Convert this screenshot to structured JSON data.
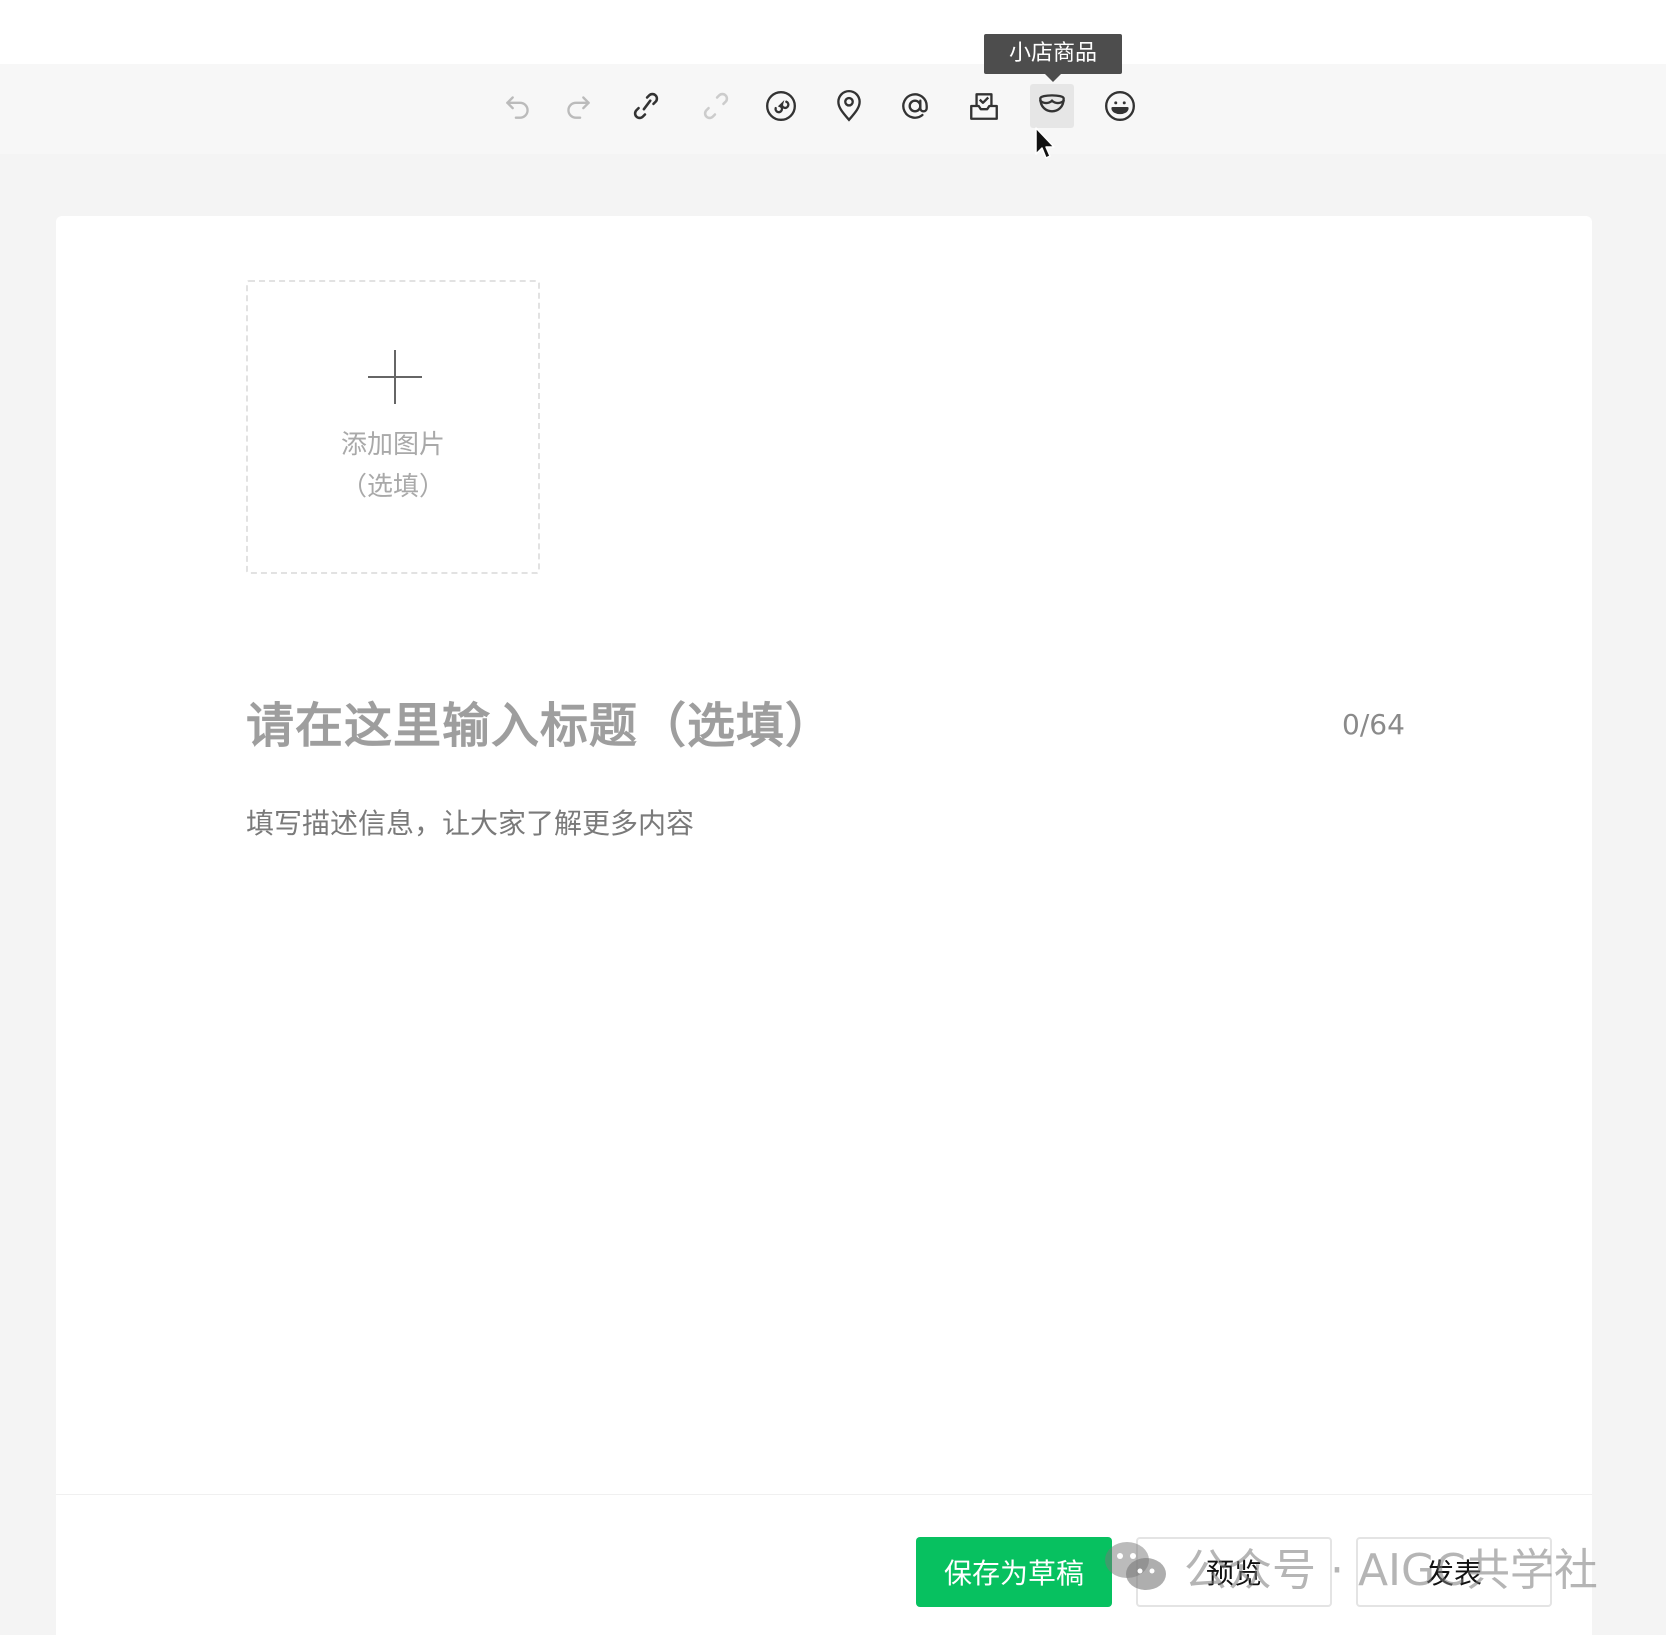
{
  "toolbar": {
    "tooltip": "小店商品",
    "buttons": [
      {
        "name": "undo-icon",
        "enabled": false
      },
      {
        "name": "redo-icon",
        "enabled": false
      },
      {
        "name": "link-icon",
        "enabled": true
      },
      {
        "name": "unlink-icon",
        "enabled": false
      },
      {
        "name": "mini-program-icon",
        "enabled": true
      },
      {
        "name": "location-icon",
        "enabled": true
      },
      {
        "name": "mention-icon",
        "enabled": true
      },
      {
        "name": "vote-inbox-icon",
        "enabled": true
      },
      {
        "name": "shop-product-icon",
        "enabled": true,
        "hovered": true
      },
      {
        "name": "emoji-icon",
        "enabled": true
      }
    ]
  },
  "editor": {
    "upload_label_line1": "添加图片",
    "upload_label_line2": "（选填）",
    "title_placeholder": "请在这里输入标题（选填）",
    "title_counter": "0/64",
    "description_placeholder": "填写描述信息，让大家了解更多内容"
  },
  "footer": {
    "save_draft_label": "保存为草稿",
    "preview_label": "预览",
    "publish_label": "发表"
  },
  "watermark": {
    "text": "公众号 · AIGC共学社"
  },
  "colors": {
    "primary_green": "#07c160",
    "toolbar_bg": "#f7f7f7",
    "page_bg": "#f4f4f4"
  }
}
